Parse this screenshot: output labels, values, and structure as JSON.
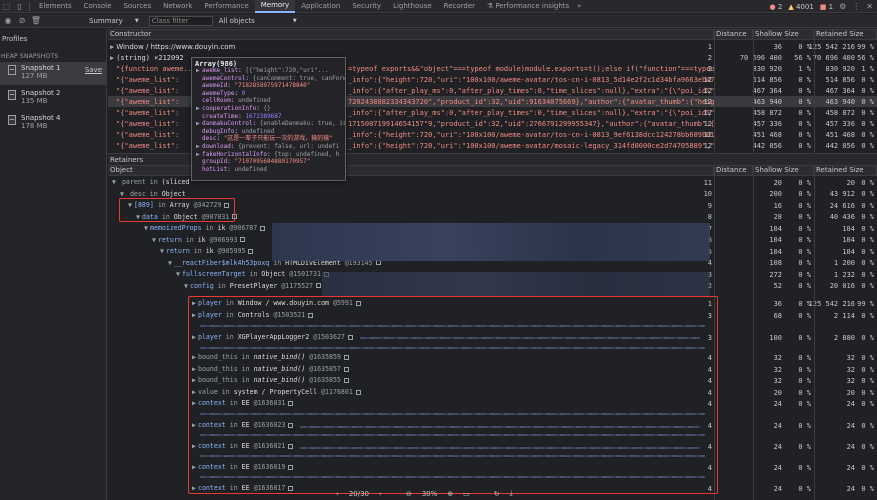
{
  "tabs": [
    "Elements",
    "Console",
    "Sources",
    "Network",
    "Performance",
    "Memory",
    "Application",
    "Security",
    "Lighthouse",
    "Recorder"
  ],
  "active_tab": "Memory",
  "perf_insights_tab": "Performance insights",
  "status": {
    "errors": "2",
    "warnings": "4001",
    "issues": "1"
  },
  "toolbar": {
    "view": "Summary",
    "filter_placeholder": "Class filter",
    "objects": "All objects"
  },
  "sidebar": {
    "title": "Profiles",
    "group": "HEAP SNAPSHOTS",
    "save": "Save",
    "snapshots": [
      {
        "name": "Snapshot 1",
        "size": "127 MB"
      },
      {
        "name": "Snapshot 2",
        "size": "135 MB"
      },
      {
        "name": "Snapshot 4",
        "size": "178 MB"
      }
    ]
  },
  "constructor_grid": {
    "headers": [
      "Constructor",
      "Distance",
      "Shallow Size",
      "",
      "Retained Size",
      ""
    ],
    "rows": [
      {
        "text": "Window / https://www.douyin.com",
        "dist": "1",
        "shallow": "36",
        "sp": "0 %",
        "retained": "125 542 216",
        "rp": "99 %"
      },
      {
        "text": "(string)  ×212092",
        "dist": "2",
        "shallow": "70 696 400",
        "sp": "56 %",
        "retained": "70 696 400",
        "rp": "56 %"
      },
      {
        "text": "\"{function aweme...",
        "tail": "=typeof exports&&\"object\"===typeof module)module.exports=t();else if(\"function\"===typeof def",
        "dist": "2",
        "shallow": "830 920",
        "sp": "1 %",
        "retained": "830 920",
        "rp": "1 %"
      },
      {
        "text": "\"{\"aweme_list\":",
        "tail": "_info\":{\"height\":720,\"uri\":\"100x100/aweme-avatar/tos-cn-i-0813_5d14e2f2c1d34bfa9663eb47192b45b2\",\"url_li",
        "dist": "12",
        "shallow": "514 856",
        "sp": "0 %",
        "retained": "514 856",
        "rp": "0 %"
      },
      {
        "text": "\"{\"aweme_list\":",
        "tail": "_info\":{\"after_play_ms\":0,\"after_play_times\":0,\"time_slices\":null},\"extra\":\"{\\\"poi_id\\\":\\\"660112375",
        "dist": "12",
        "shallow": "467 364",
        "sp": "0 %",
        "retained": "467 364",
        "rp": "0 %"
      },
      {
        "text": "\"{\"aweme_list\":",
        "tail": "7202438882334343720\",\"product_id\":32,\"uid\":91634075669},\"author\":{\"avatar_thumb\":{\"height\":720,\"uri\"",
        "dist": "12",
        "shallow": "463 940",
        "sp": "0 %",
        "retained": "463 940",
        "rp": "0 %",
        "sel": true
      },
      {
        "text": "\"{\"aweme_list\":",
        "tail": "_info\":{\"after_play_ms\":0,\"after_play_times\":0,\"time_slices\":null},\"extra\":\"{\\\"poi_id\\\":\\\"660113922",
        "dist": "12",
        "shallow": "458 872",
        "sp": "0 %",
        "retained": "458 872",
        "rp": "0 %"
      },
      {
        "text": "\"{\"aweme_list\":",
        "tail": "171500719914654157\"9,\"product_id\":32,\"uid\":2766791299955347},\"author\":{\"avatar_thumb\":{\"height\":720,",
        "dist": "12",
        "shallow": "457 336",
        "sp": "0 %",
        "retained": "457 336",
        "rp": "0 %"
      },
      {
        "text": "\"{\"aweme_list\":",
        "tail": "_info\":{\"height\":720,\"uri\":\"100x100/aweme-avatar/tos-cn-i-0813_9ef6138dcc124278bb689b012c808047\",\"url_li",
        "dist": "12",
        "shallow": "451 468",
        "sp": "0 %",
        "retained": "451 468",
        "rp": "0 %"
      },
      {
        "text": "\"{\"aweme_list\":",
        "tail": "_info\":{\"height\":720,\"uri\":\"100x100/aweme-avatar/mosaic-legacy_314fd0000ce2d74705889\",\"url_list\":[\"https",
        "dist": "12",
        "shallow": "442 056",
        "sp": "0 %",
        "retained": "442 056",
        "rp": "0 %"
      }
    ]
  },
  "tooltip": {
    "title": "Array(986)",
    "lines": [
      {
        "arrow": "▶",
        "key": "aweme_list",
        "sep": ": ",
        "val": "[{\"height\":720,\"uri\"..."
      },
      {
        "arrow": "",
        "key": "awemeControl",
        "sep": ": ",
        "val": "{canComment: true, canForward..."
      },
      {
        "arrow": "",
        "key": "awemeId",
        "sep": ": ",
        "val": "\"7182858975971478840\""
      },
      {
        "arrow": "",
        "key": "awemeType",
        "sep": ": ",
        "val": "0"
      },
      {
        "arrow": "",
        "key": "cellRoom",
        "sep": ": ",
        "val": "undefined"
      },
      {
        "arrow": "▶",
        "key": "cooperationInfo",
        "sep": ": ",
        "val": "{}"
      },
      {
        "arrow": "",
        "key": "createTime",
        "sep": ": ",
        "val": "1672389687"
      },
      {
        "arrow": "▶",
        "key": "danmakuControl",
        "sep": ": ",
        "val": "{enableDanmaku: true, isP"
      },
      {
        "arrow": "",
        "key": "debugInfo",
        "sep": ": ",
        "val": "undefined"
      },
      {
        "arrow": "",
        "key": "desc",
        "sep": ": ",
        "val": "\"这是一辈子只能玩一次的游戏，输的输\""
      },
      {
        "arrow": "▶",
        "key": "download",
        "sep": ": ",
        "val": "{prevent: false, url: undefi"
      },
      {
        "arrow": "▶",
        "key": "fakeHorizontalInfo",
        "sep": ": ",
        "val": "{top: undefined, h"
      },
      {
        "arrow": "",
        "key": "groupId",
        "sep": ": ",
        "val": "\"7107095684880170957\""
      },
      {
        "arrow": "",
        "key": "hotList",
        "sep": ": ",
        "val": "undefined"
      }
    ]
  },
  "retainers_title": "Retainers",
  "retainer_grid": {
    "headers": [
      "Object",
      "Distance",
      "Shallow Size",
      "",
      "Retained Size",
      ""
    ],
    "rows": [
      {
        "parts": [
          [
            "tri",
            "▼"
          ],
          [
            "kwd",
            " parent in "
          ],
          [
            "lbl",
            "(sliced"
          ]
        ],
        "dist": "11",
        "shallow": "20",
        "sp": "0 %",
        "retained": "20",
        "rp": "0 %"
      },
      {
        "parts": [
          [
            "tri",
            "▼"
          ],
          [
            "kwd",
            " desc in "
          ],
          [
            "lbl",
            "Object"
          ]
        ],
        "dist": "10",
        "shallow": "200",
        "sp": "0 %",
        "retained": "43 912",
        "rp": "0 %"
      },
      {
        "parts": [
          [
            "tri",
            "▼"
          ],
          [
            "pk",
            "[889]"
          ],
          [
            "kwd",
            " in "
          ],
          [
            "lbl",
            "Array "
          ],
          [
            "id",
            "@342729"
          ]
        ],
        "dist": "9",
        "shallow": "16",
        "sp": "0 %",
        "retained": "24 616",
        "rp": "0 %"
      },
      {
        "parts": [
          [
            "tri",
            "▼"
          ],
          [
            "pk",
            "data"
          ],
          [
            "kwd",
            " in "
          ],
          [
            "lbl",
            "Object "
          ],
          [
            "id",
            "@907031"
          ]
        ],
        "dist": "8",
        "shallow": "28",
        "sp": "0 %",
        "retained": "40 436",
        "rp": "0 %"
      },
      {
        "parts": [
          [
            "tri",
            "▼"
          ],
          [
            "pk",
            "memoizedProps"
          ],
          [
            "kwd",
            " in "
          ],
          [
            "lbl",
            "ik "
          ],
          [
            "id",
            "@906787"
          ]
        ],
        "dist": "7",
        "shallow": "104",
        "sp": "0 %",
        "retained": "104",
        "rp": "0 %"
      },
      {
        "parts": [
          [
            "tri",
            "▼"
          ],
          [
            "pk",
            "return"
          ],
          [
            "kwd",
            " in "
          ],
          [
            "lbl",
            "ik "
          ],
          [
            "id",
            "@906993"
          ]
        ],
        "dist": "6",
        "shallow": "104",
        "sp": "0 %",
        "retained": "104",
        "rp": "0 %"
      },
      {
        "parts": [
          [
            "tri",
            "▼"
          ],
          [
            "pk",
            "return"
          ],
          [
            "kwd",
            " in "
          ],
          [
            "lbl",
            "ik "
          ],
          [
            "id",
            "@905995"
          ]
        ],
        "dist": "5",
        "shallow": "104",
        "sp": "0 %",
        "retained": "104",
        "rp": "0 %"
      },
      {
        "parts": [
          [
            "tri",
            "▼"
          ],
          [
            "pk",
            "__reactFiber$mlk4h53poxq"
          ],
          [
            "kwd",
            " in "
          ],
          [
            "lbl",
            "HTMLDivElement "
          ],
          [
            "id",
            "@193145"
          ]
        ],
        "dist": "4",
        "shallow": "108",
        "sp": "0 %",
        "retained": "1 200",
        "rp": "0 %"
      },
      {
        "parts": [
          [
            "tri",
            "▼"
          ],
          [
            "pk",
            "fullscreenTarget"
          ],
          [
            "kwd",
            " in "
          ],
          [
            "lbl",
            "Object "
          ],
          [
            "id",
            "@1501731"
          ]
        ],
        "dist": "3",
        "shallow": "272",
        "sp": "0 %",
        "retained": "1 232",
        "rp": "0 %"
      },
      {
        "parts": [
          [
            "tri",
            "▼"
          ],
          [
            "pk",
            "config"
          ],
          [
            "kwd",
            " in "
          ],
          [
            "lbl",
            "PresetPlayer "
          ],
          [
            "id",
            "@1175527"
          ]
        ],
        "dist": "2",
        "shallow": "52",
        "sp": "0 %",
        "retained": "20 016",
        "rp": "0 %"
      }
    ]
  },
  "retainer_children": [
    {
      "parts": [
        [
          "tri",
          "▶"
        ],
        [
          "pk",
          "player"
        ],
        [
          "kwd",
          " in "
        ],
        [
          "lbl",
          "Window / www.douyin.com "
        ],
        [
          "id",
          "@5991"
        ]
      ],
      "dist": "1",
      "shallow": "36",
      "sp": "0 %",
      "retained": "125 542 216",
      "rp": "99 %"
    },
    {
      "parts": [
        [
          "tri",
          "▶"
        ],
        [
          "pk",
          "player"
        ],
        [
          "kwd",
          " in "
        ],
        [
          "lbl",
          "Controls "
        ],
        [
          "id",
          "@1503521"
        ]
      ],
      "dist": "3",
      "shallow": "68",
      "sp": "0 %",
      "retained": "2 114",
      "rp": "0 %"
    },
    {
      "parts": [
        [
          "tri",
          "▶"
        ],
        [
          "pk",
          "player"
        ],
        [
          "kwd",
          " in "
        ],
        [
          "lbl",
          "XGPlayerAppLogger2 "
        ],
        [
          "id",
          "@1503627"
        ]
      ],
      "dist": "3",
      "shallow": "100",
      "sp": "0 %",
      "retained": "2 880",
      "rp": "0 %"
    },
    {
      "parts": [
        [
          "tri",
          "▶"
        ],
        [
          "kwd",
          "bound_this in "
        ],
        [
          "fn",
          "native_bind() "
        ],
        [
          "id",
          "@1635859"
        ]
      ],
      "dist": "4",
      "shallow": "32",
      "sp": "0 %",
      "retained": "32",
      "rp": "0 %"
    },
    {
      "parts": [
        [
          "tri",
          "▶"
        ],
        [
          "kwd",
          "bound_this in "
        ],
        [
          "fn",
          "native_bind() "
        ],
        [
          "id",
          "@1635857"
        ]
      ],
      "dist": "4",
      "shallow": "32",
      "sp": "0 %",
      "retained": "32",
      "rp": "0 %"
    },
    {
      "parts": [
        [
          "tri",
          "▶"
        ],
        [
          "kwd",
          "bound_this in "
        ],
        [
          "fn",
          "native_bind() "
        ],
        [
          "id",
          "@1635855"
        ]
      ],
      "dist": "4",
      "shallow": "32",
      "sp": "0 %",
      "retained": "32",
      "rp": "0 %"
    },
    {
      "parts": [
        [
          "tri",
          "▶"
        ],
        [
          "kwd",
          "value in "
        ],
        [
          "lbl",
          "system / PropertyCell "
        ],
        [
          "id",
          "@1176801"
        ]
      ],
      "dist": "4",
      "shallow": "20",
      "sp": "0 %",
      "retained": "20",
      "rp": "0 %"
    },
    {
      "parts": [
        [
          "tri",
          "▶"
        ],
        [
          "pk",
          "context"
        ],
        [
          "kwd",
          " in "
        ],
        [
          "lbl",
          "EE "
        ],
        [
          "id",
          "@1636031"
        ]
      ],
      "dist": "4",
      "shallow": "24",
      "sp": "0 %",
      "retained": "24",
      "rp": "0 %"
    },
    {
      "parts": [
        [
          "tri",
          "▶"
        ],
        [
          "pk",
          "context"
        ],
        [
          "kwd",
          " in "
        ],
        [
          "lbl",
          "EE "
        ],
        [
          "id",
          "@1636023"
        ]
      ],
      "dist": "4",
      "shallow": "24",
      "sp": "0 %",
      "retained": "24",
      "rp": "0 %"
    },
    {
      "parts": [
        [
          "tri",
          "▶"
        ],
        [
          "pk",
          "context"
        ],
        [
          "kwd",
          " in "
        ],
        [
          "lbl",
          "EE "
        ],
        [
          "id",
          "@1636021"
        ]
      ],
      "dist": "4",
      "shallow": "24",
      "sp": "0 %",
      "retained": "24",
      "rp": "0 %"
    },
    {
      "parts": [
        [
          "tri",
          "▶"
        ],
        [
          "pk",
          "context"
        ],
        [
          "kwd",
          " in "
        ],
        [
          "lbl",
          "EE "
        ],
        [
          "id",
          "@1636019"
        ]
      ],
      "dist": "4",
      "shallow": "24",
      "sp": "0 %",
      "retained": "24",
      "rp": "0 %"
    },
    {
      "parts": [
        [
          "tri",
          "▶"
        ],
        [
          "pk",
          "context"
        ],
        [
          "kwd",
          " in "
        ],
        [
          "lbl",
          "EE "
        ],
        [
          "id",
          "@1636017"
        ]
      ],
      "dist": "4",
      "shallow": "24",
      "sp": "0 %",
      "retained": "24",
      "rp": "0 %"
    }
  ],
  "bottom": {
    "page": "20/30",
    "zoom": "30%"
  }
}
